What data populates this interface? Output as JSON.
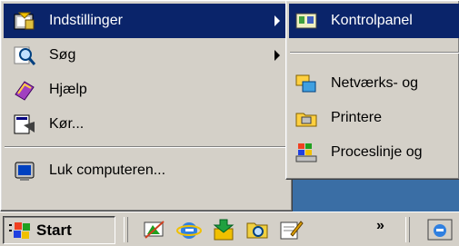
{
  "start_menu": {
    "items": [
      {
        "label": "Indstillinger",
        "icon": "settings-icon",
        "selected": true,
        "has_submenu": true
      },
      {
        "label": "Søg",
        "icon": "search-icon",
        "selected": false,
        "has_submenu": true
      },
      {
        "label": "Hjælp",
        "icon": "help-book-icon",
        "selected": false,
        "has_submenu": false
      },
      {
        "label": "Kør...",
        "icon": "run-icon",
        "selected": false,
        "has_submenu": false
      },
      {
        "label": "Luk computeren...",
        "icon": "shutdown-icon",
        "selected": false,
        "has_submenu": false
      }
    ]
  },
  "submenu": {
    "items": [
      {
        "label": "Kontrolpanel",
        "icon": "control-panel-icon",
        "selected": true
      },
      {
        "label": "Netværks- og",
        "icon": "network-icon",
        "selected": false
      },
      {
        "label": "Printere",
        "icon": "printer-icon",
        "selected": false
      },
      {
        "label": "Proceslinje og",
        "icon": "taskbar-icon",
        "selected": false
      }
    ]
  },
  "taskbar": {
    "start_label": "Start",
    "quicklaunch_icons": [
      "desktop-icon",
      "internet-explorer-icon",
      "outlook-express-icon",
      "explorer-icon",
      "notepad-icon"
    ],
    "chevron": "»",
    "window_icon": "ie-window-icon"
  },
  "colors": {
    "selection": "#0a246a",
    "menu_face": "#d4d0c8",
    "desktop": "#3a6ea5"
  }
}
